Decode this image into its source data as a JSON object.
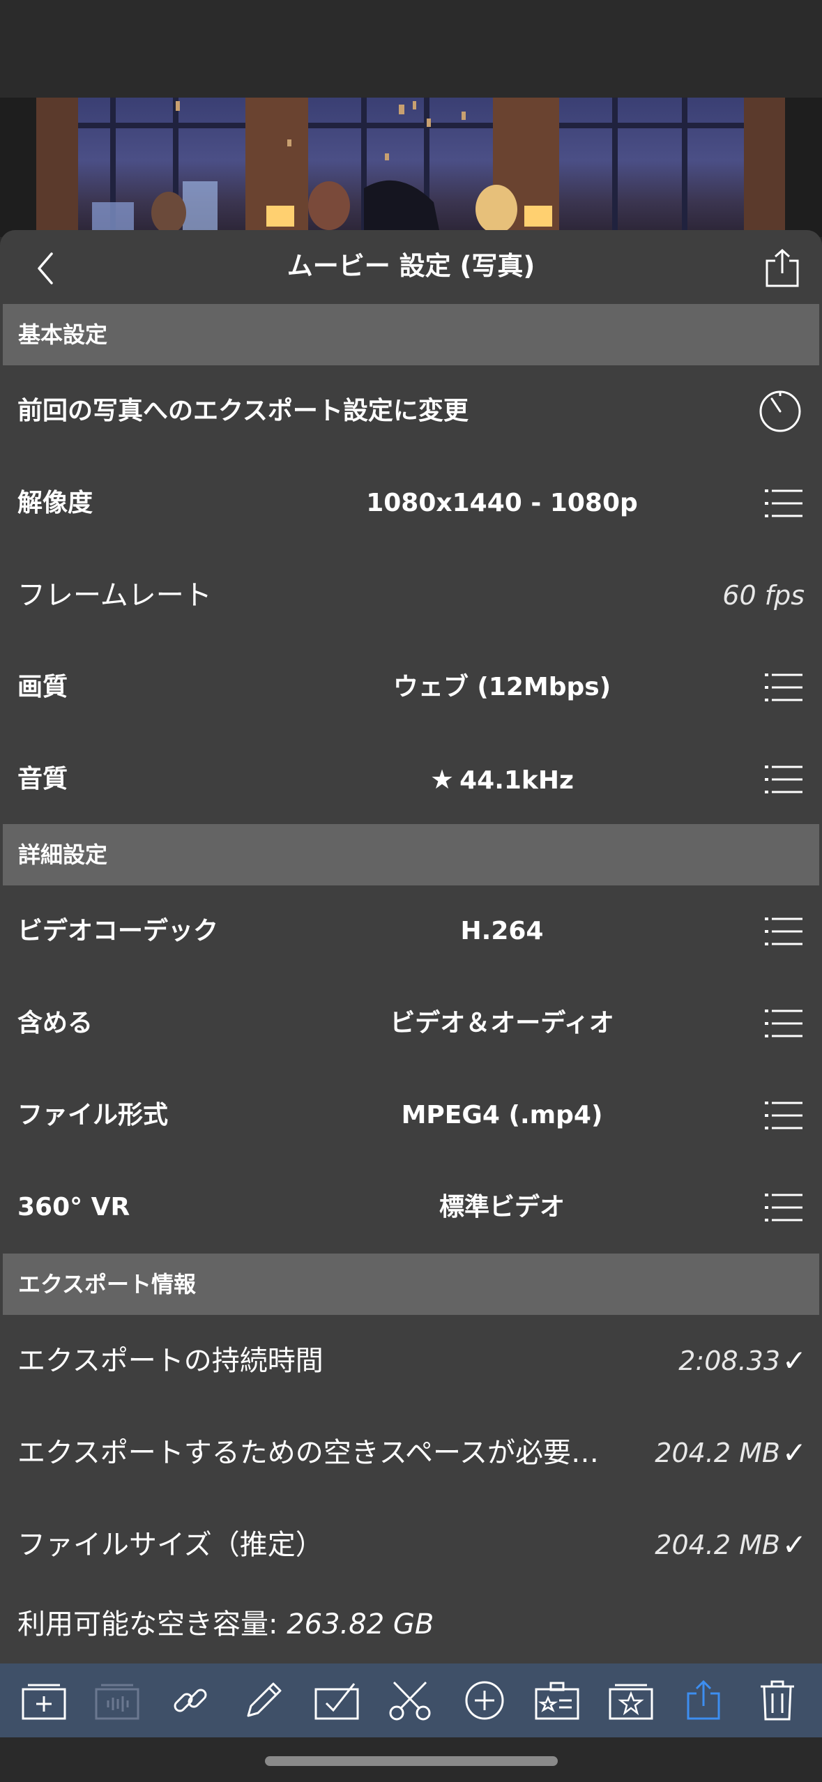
{
  "nav": {
    "title": "ムービー 設定 (写真)"
  },
  "sections": {
    "basic": "基本設定",
    "detail": "詳細設定",
    "export_info": "エクスポート情報"
  },
  "basic_rows": {
    "previous_export": "前回の写真へのエクスポート設定に変更",
    "resolution_label": "解像度",
    "resolution_value": "1080x1440 - 1080p",
    "framerate_label": "フレームレート",
    "framerate_value": "60 fps",
    "quality_label": "画質",
    "quality_value": "ウェブ (12Mbps)",
    "audio_label": "音質",
    "audio_star": "★",
    "audio_value": "44.1kHz"
  },
  "detail_rows": {
    "codec_label": "ビデオコーデック",
    "codec_value": "H.264",
    "include_label": "含める",
    "include_value": "ビデオ＆オーディオ",
    "format_label": "ファイル形式",
    "format_value": "MPEG4 (.mp4)",
    "vr_label": "360° VR",
    "vr_value": "標準ビデオ"
  },
  "export_rows": {
    "duration_label": "エクスポートの持続時間",
    "duration_value": "2:08.33",
    "space_label": "エクスポートするための空きスペースが必要…",
    "space_value": "204.2 MB",
    "filesize_label": "ファイルサイズ（推定）",
    "filesize_value": "204.2 MB",
    "available_label": "利用可能な空き容量:",
    "available_value": "263.82 GB",
    "check": "✓"
  },
  "colors": {
    "sheet_bg": "#3f3f3f",
    "section_bg": "#646464",
    "toolbar_bg": "#3f5068",
    "accent_blue": "#3d8ef0"
  },
  "toolbar_icons": [
    "add-clip-icon",
    "audio-clip-icon",
    "link-icon",
    "pencil-icon",
    "checkbox-icon",
    "scissors-icon",
    "plus-circle-icon",
    "title-card-icon",
    "favorite-icon",
    "share-icon",
    "trash-icon"
  ]
}
